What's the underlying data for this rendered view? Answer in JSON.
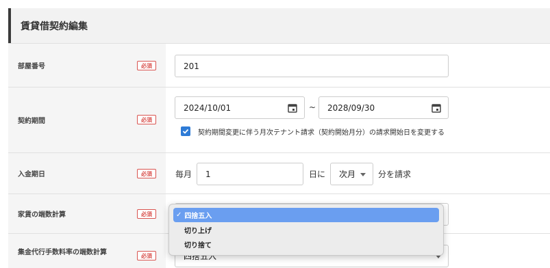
{
  "header": {
    "title": "賃貸借契約編集"
  },
  "required_label": "必須",
  "room_number": {
    "label": "部屋番号",
    "value": "201"
  },
  "contract_period": {
    "label": "契約期間",
    "start": "2024/10/01",
    "separator": "~",
    "end": "2028/09/30",
    "checkbox_checked": true,
    "checkbox_label": "契約期間変更に伴う月次テナント請求（契約開始月分）の請求開始日を変更する"
  },
  "payment_date": {
    "label": "入金期日",
    "prefix": "毎月",
    "day": "1",
    "day_suffix": "日に",
    "month_select": "次月",
    "suffix": "分を請求"
  },
  "rent_rounding": {
    "label": "家賃の端数計算",
    "options": [
      "四捨五入",
      "切り上げ",
      "切り捨て"
    ],
    "checkmark": "✓"
  },
  "collection_fee_rounding": {
    "label": "集金代行手数料率の端数計算",
    "value": "四捨五入"
  },
  "colors": {
    "required": "#d9534f",
    "check": "#2e7bd6",
    "selected_option": "#6a9ef0"
  }
}
